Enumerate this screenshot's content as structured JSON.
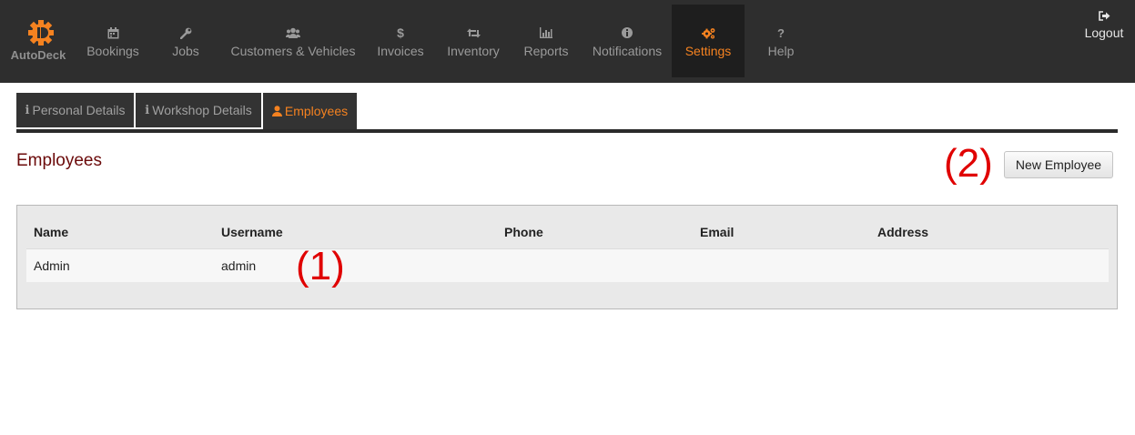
{
  "brand": {
    "name": "AutoDeck",
    "color": "#f58220"
  },
  "nav": {
    "items": [
      {
        "label": "Bookings",
        "icon": "calendar-icon"
      },
      {
        "label": "Jobs",
        "icon": "wrench-icon"
      },
      {
        "label": "Customers & Vehicles",
        "icon": "users-icon"
      },
      {
        "label": "Invoices",
        "icon": "dollar-icon"
      },
      {
        "label": "Inventory",
        "icon": "retweet-icon"
      },
      {
        "label": "Reports",
        "icon": "bar-chart-icon"
      },
      {
        "label": "Notifications",
        "icon": "info-circle-icon"
      },
      {
        "label": "Settings",
        "icon": "cogs-icon",
        "active": true
      },
      {
        "label": "Help",
        "icon": "question-icon"
      }
    ],
    "logout": {
      "label": "Logout",
      "icon": "sign-out-icon"
    }
  },
  "tabs": [
    {
      "label": "Personal Details",
      "icon": "info-icon"
    },
    {
      "label": "Workshop Details",
      "icon": "info-icon"
    },
    {
      "label": "Employees",
      "icon": "user-icon",
      "active": true
    }
  ],
  "page": {
    "title": "Employees",
    "new_button": "New Employee"
  },
  "annotations": {
    "one": "(1)",
    "two": "(2)",
    "color": "#e00000"
  },
  "table": {
    "headers": [
      "Name",
      "Username",
      "Phone",
      "Email",
      "Address"
    ],
    "rows": [
      {
        "name": "Admin",
        "username": "admin",
        "phone": "",
        "email": "",
        "address": ""
      }
    ]
  },
  "colors": {
    "accent": "#f58220",
    "navbar": "#2e2e2e",
    "title": "#6b0a0a"
  }
}
